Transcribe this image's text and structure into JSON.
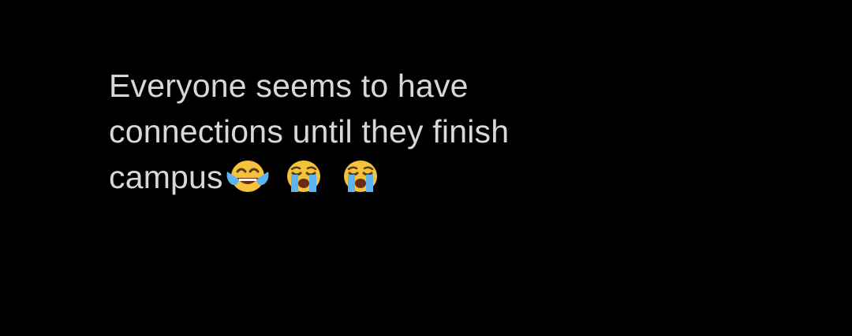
{
  "post": {
    "line1": "Everyone seems to have",
    "line2": "connections until they finish",
    "line3": "campus",
    "emojis": [
      {
        "name": "face-with-tears-of-joy-icon",
        "char": "😂"
      },
      {
        "name": "loudly-crying-face-icon",
        "char": "😭"
      },
      {
        "name": "loudly-crying-face-icon",
        "char": "😭"
      }
    ]
  },
  "colors": {
    "background": "#000000",
    "text": "#d8d8d8",
    "emoji_face": "#f5c33b",
    "emoji_tears": "#5db3f0"
  }
}
